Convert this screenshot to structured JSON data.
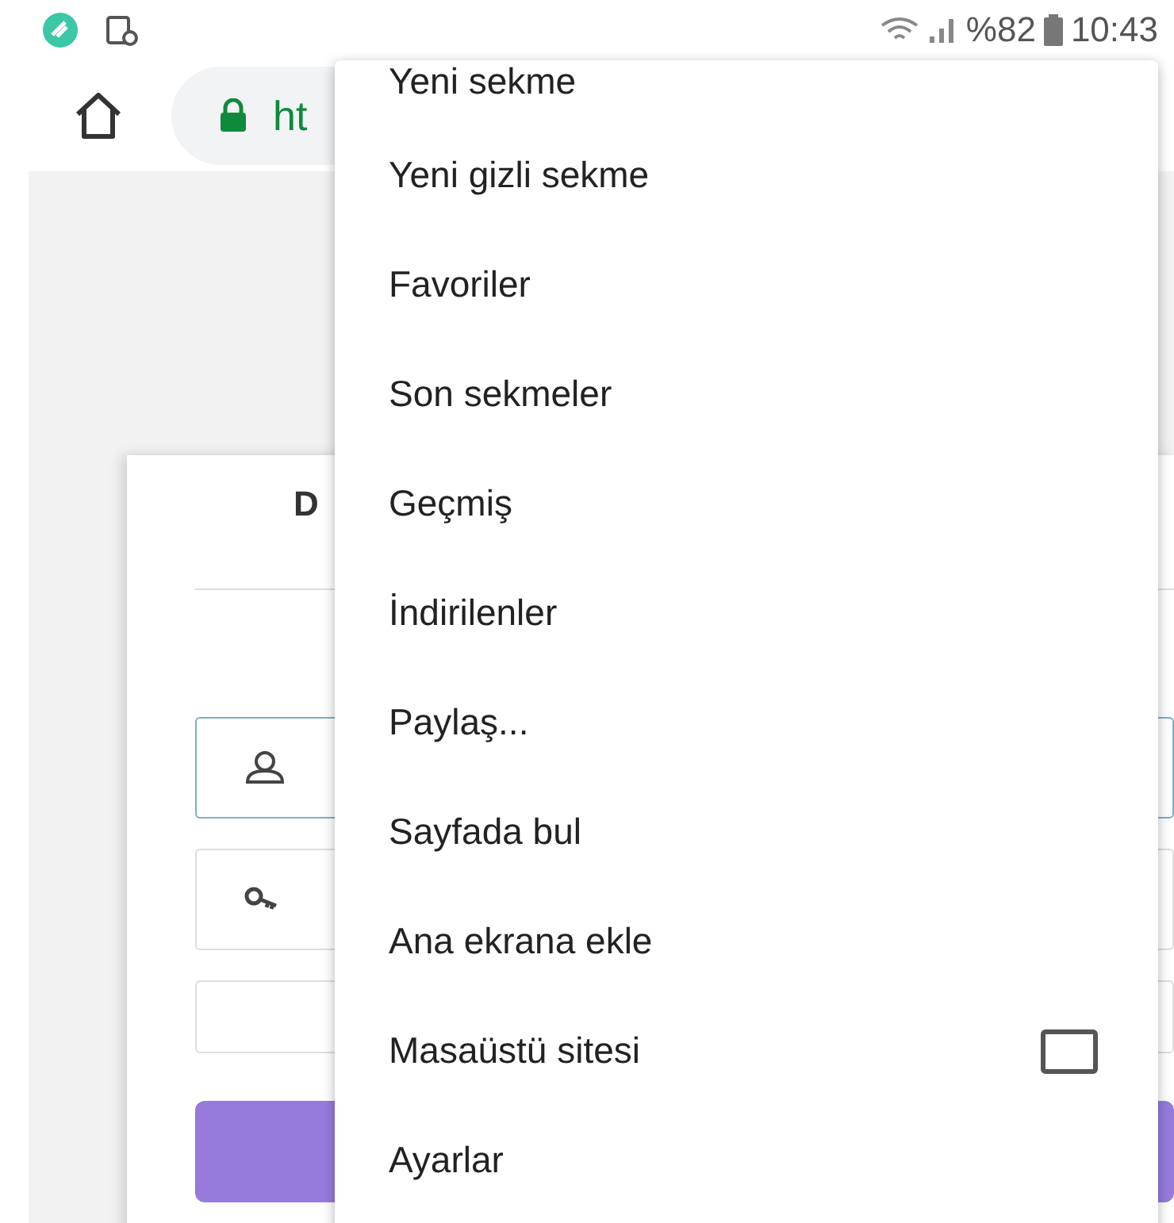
{
  "status_bar": {
    "battery": "%82",
    "time": "10:43"
  },
  "toolbar": {
    "url": "ht"
  },
  "login_card": {
    "title": "D"
  },
  "menu": {
    "items": [
      {
        "label": "Yeni sekme",
        "kind": "action"
      },
      {
        "label": "Yeni gizli sekme",
        "kind": "action"
      },
      {
        "label": "Favoriler",
        "kind": "action"
      },
      {
        "label": "Son sekmeler",
        "kind": "action"
      },
      {
        "label": "Geçmiş",
        "kind": "action"
      },
      {
        "label": "İndirilenler",
        "kind": "action"
      },
      {
        "label": "Paylaş...",
        "kind": "action"
      },
      {
        "label": "Sayfada bul",
        "kind": "action"
      },
      {
        "label": "Ana ekrana ekle",
        "kind": "action"
      },
      {
        "label": "Masaüstü sitesi",
        "kind": "checkbox",
        "checked": false
      },
      {
        "label": "Ayarlar",
        "kind": "action"
      }
    ]
  }
}
